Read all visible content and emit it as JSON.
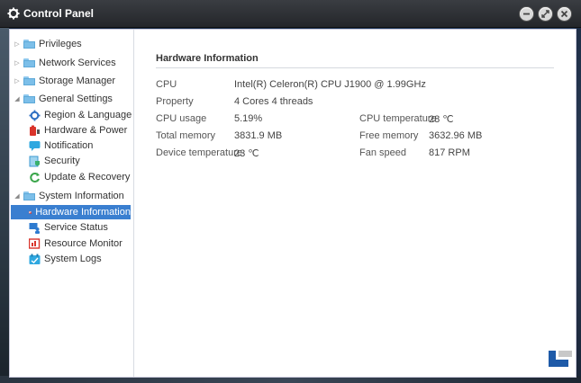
{
  "window": {
    "title": "Control Panel",
    "buttons": [
      "minimize",
      "maximize",
      "close"
    ]
  },
  "sidebar": {
    "items": [
      {
        "label": "Privileges",
        "type": "folder",
        "expanded": false,
        "level": 0
      },
      {
        "label": "Network Services",
        "type": "folder",
        "expanded": false,
        "level": 0
      },
      {
        "label": "Storage Manager",
        "type": "folder",
        "expanded": false,
        "level": 0
      },
      {
        "label": "General Settings",
        "type": "folder",
        "expanded": true,
        "level": 0
      },
      {
        "label": "Region & Language",
        "icon": "gear-icon",
        "level": 1
      },
      {
        "label": "Hardware & Power",
        "icon": "power-icon",
        "level": 1
      },
      {
        "label": "Notification",
        "icon": "chat-icon",
        "level": 1
      },
      {
        "label": "Security",
        "icon": "shield-icon",
        "level": 1
      },
      {
        "label": "Update & Recovery",
        "icon": "refresh-icon",
        "level": 1
      },
      {
        "label": "System Information",
        "type": "folder",
        "expanded": true,
        "level": 0
      },
      {
        "label": "Hardware Information",
        "icon": "hardware-icon",
        "level": 1,
        "selected": true
      },
      {
        "label": "Service Status",
        "icon": "monitor-user-icon",
        "level": 1
      },
      {
        "label": "Resource Monitor",
        "icon": "resource-icon",
        "level": 1
      },
      {
        "label": "System Logs",
        "icon": "log-icon",
        "level": 1
      }
    ]
  },
  "hardware": {
    "title": "Hardware Information",
    "cpu_label": "CPU",
    "cpu_value": "Intel(R) Celeron(R) CPU J1900 @ 1.99GHz",
    "property_label": "Property",
    "property_value": "4 Cores 4 threads",
    "cpu_usage_label": "CPU usage",
    "cpu_usage_value": "5.19%",
    "cpu_temp_label": "CPU temperature",
    "cpu_temp_value": "28 ℃",
    "total_memory_label": "Total memory",
    "total_memory_value": "3831.9 MB",
    "free_memory_label": "Free memory",
    "free_memory_value": "3632.96 MB",
    "device_temp_label": "Device temperature",
    "device_temp_value": "23 ℃",
    "fan_speed_label": "Fan speed",
    "fan_speed_value": "817 RPM"
  },
  "colors": {
    "selection": "#3a7fd0",
    "titlebar": "#2b2d31",
    "folder": "#7cbfe9"
  }
}
